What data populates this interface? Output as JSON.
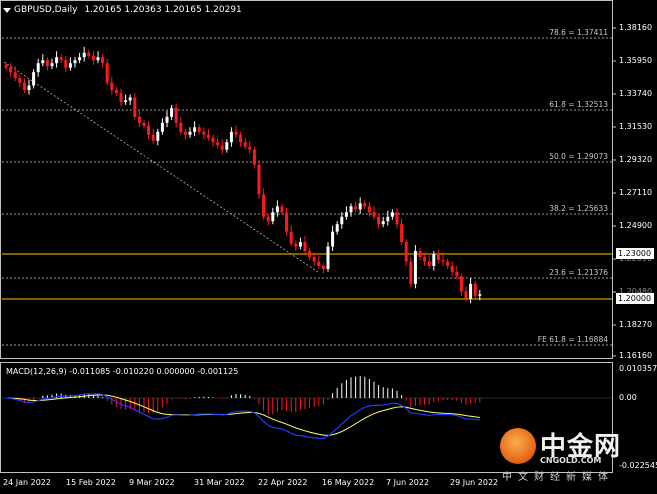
{
  "header": {
    "symbol": "GBPUSD,Daily",
    "ohlc": "1.20165 1.20363 1.20165 1.20291"
  },
  "macd_header": "MACD(12,26,9) -0.011085 -0.010220 0.000000 -0.001125",
  "price_axis": [
    "1.38160",
    "1.35950",
    "1.33740",
    "1.31530",
    "1.29320",
    "1.27110",
    "1.24900",
    "1.22690",
    "1.20480",
    "1.18270",
    "1.16160"
  ],
  "macd_axis": [
    "0.010357",
    "0.00",
    "-0.022545"
  ],
  "price_boxes": [
    {
      "label": "1.23000",
      "color": "#ffc000"
    },
    {
      "label": "1.20000",
      "color": "#ffc000"
    }
  ],
  "fib_levels": [
    {
      "label": "78.6 = 1.37411"
    },
    {
      "label": "61.8 = 1.32513"
    },
    {
      "label": "50.0 = 1.29073"
    },
    {
      "label": "38.2 = 1.25633"
    },
    {
      "label": "23.6 = 1.21376"
    },
    {
      "label": "FE 61.8 = 1.16884"
    }
  ],
  "date_axis": [
    "24 Jan 2022",
    "15 Feb 2022",
    "9 Mar 2022",
    "31 Mar 2022",
    "22 Apr 2022",
    "16 May 2022",
    "7 Jun 2022",
    "29 Jun 2022"
  ],
  "colors": {
    "bull": "#ffffff",
    "bear": "#ff1a1a",
    "signal": "#ffff66",
    "macd_line": "#1a3cff",
    "hline": "#ffc000"
  },
  "logo": {
    "text": "中金网",
    "url": "CNGOLD.COM",
    "sub": "中文财经新媒体"
  },
  "chart_data": {
    "type": "candlestick",
    "closes": [
      1.355,
      1.352,
      1.348,
      1.345,
      1.34,
      1.343,
      1.352,
      1.358,
      1.36,
      1.356,
      1.358,
      1.362,
      1.36,
      1.355,
      1.358,
      1.36,
      1.362,
      1.365,
      1.363,
      1.36,
      1.362,
      1.358,
      1.345,
      1.34,
      1.338,
      1.332,
      1.333,
      1.335,
      1.322,
      1.318,
      1.316,
      1.31,
      1.306,
      1.312,
      1.318,
      1.322,
      1.328,
      1.318,
      1.312,
      1.31,
      1.312,
      1.315,
      1.312,
      1.31,
      1.308,
      1.305,
      1.303,
      1.3,
      1.305,
      1.312,
      1.31,
      1.305,
      1.302,
      1.3,
      1.29,
      1.27,
      1.255,
      1.252,
      1.258,
      1.262,
      1.258,
      1.245,
      1.237,
      1.235,
      1.238,
      1.232,
      1.228,
      1.225,
      1.222,
      1.22,
      1.235,
      1.245,
      1.25,
      1.255,
      1.258,
      1.262,
      1.26,
      1.264,
      1.262,
      1.258,
      1.255,
      1.25,
      1.252,
      1.255,
      1.258,
      1.25,
      1.238,
      1.225,
      1.21,
      1.232,
      1.228,
      1.225,
      1.222,
      1.23,
      1.226,
      1.225,
      1.222,
      1.218,
      1.215,
      1.205,
      1.2,
      1.21,
      1.202,
      1.203
    ]
  }
}
